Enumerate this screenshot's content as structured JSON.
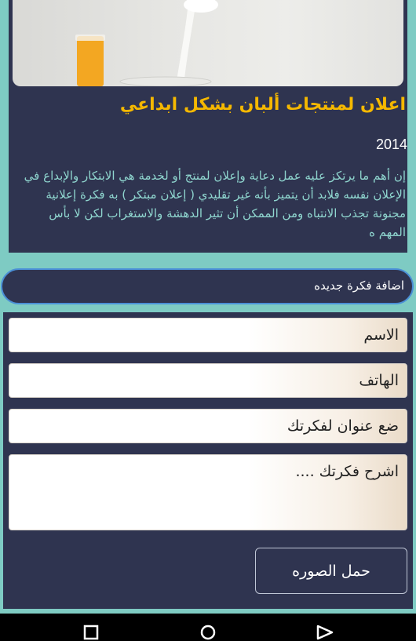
{
  "article": {
    "title": "اعلان لمنتجات ألبان بشكل ابداعي",
    "year": "2014",
    "body": "إن أهم ما يرتكز عليه عمل دعاية وإعلان لمنتج أو لخدمة هي الابتكار والإبداع في الإعلان نفسه فلابد أن يتميز بأنه غير تقليدي ( إعلان مبتكر ) به فكرة إعلانية مجنونة تجذب الانتباه ومن الممكن أن تثير الدهشة والاستغراب لكن لا بأس المهم ه"
  },
  "add_idea": {
    "label": "اضافة فكرة جديده"
  },
  "form": {
    "name_placeholder": "الاسم",
    "phone_placeholder": "الهاتف",
    "title_placeholder": "ضع عنوان لفكرتك",
    "desc_placeholder": "اشرح فكرتك ....",
    "upload_label": "حمل الصوره"
  },
  "nav": {
    "icons": [
      "back-icon",
      "home-icon",
      "recent-apps-icon"
    ]
  },
  "colors": {
    "background": "#7ecbc3",
    "panel": "#2f3450",
    "title": "#f5b800",
    "body_text": "#8fd6cf",
    "bar_border": "#4a8fd6"
  }
}
